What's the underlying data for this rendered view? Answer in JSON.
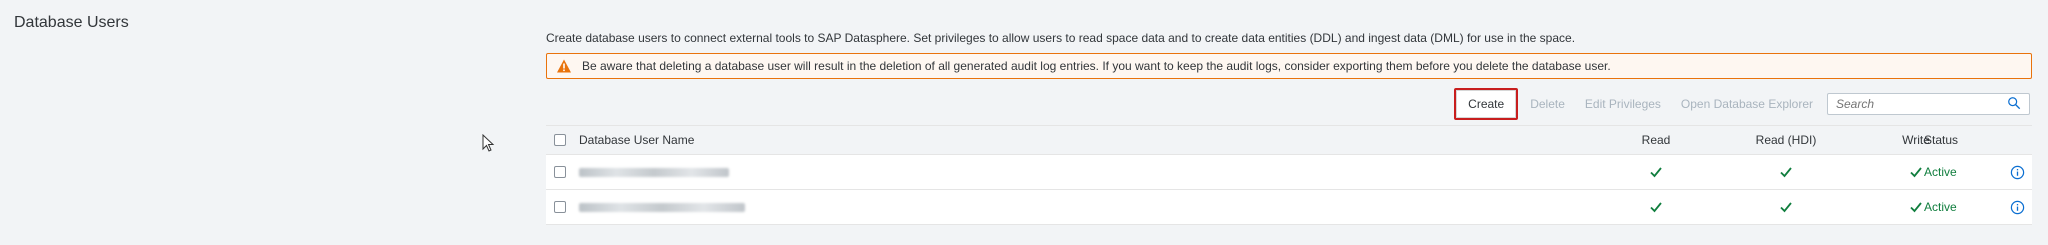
{
  "section": {
    "title": "Database Users"
  },
  "description": "Create database users to connect external tools to SAP Datasphere. Set privileges to allow users to read space data and to create data entities (DDL) and ingest data (DML) for use in the space.",
  "warning": {
    "icon": "warning-icon",
    "color": "#e9730c",
    "text": "Be aware that deleting a database user will result in the deletion of all generated audit log entries. If you want to keep the audit logs, consider exporting them before you delete the database user."
  },
  "toolbar": {
    "create": "Create",
    "delete": "Delete",
    "edit_privileges": "Edit Privileges",
    "open_explorer": "Open Database Explorer",
    "search_placeholder": "Search"
  },
  "table": {
    "columns": {
      "name": "Database User Name",
      "read": "Read",
      "read_hdi": "Read (HDI)",
      "write": "Write",
      "status": "Status"
    },
    "rows": [
      {
        "name_blurred": true,
        "read": true,
        "read_hdi": true,
        "write": true,
        "status": "Active"
      },
      {
        "name_blurred": true,
        "read": true,
        "read_hdi": true,
        "write": true,
        "status": "Active"
      }
    ]
  },
  "colors": {
    "active": "#107e3e",
    "accent": "#0a6ed1",
    "highlight_border": "#c81e1e"
  }
}
